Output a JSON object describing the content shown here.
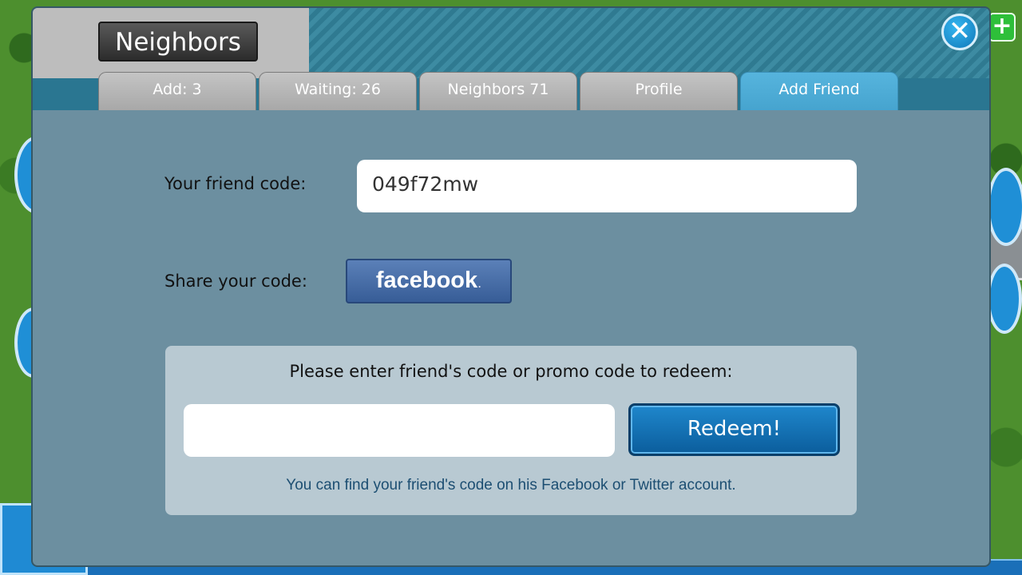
{
  "modal": {
    "title": "Neighbors",
    "close_icon": "close-icon"
  },
  "tabs": [
    {
      "label": "Add: 3",
      "active": false
    },
    {
      "label": "Waiting: 26",
      "active": false
    },
    {
      "label": "Neighbors 71",
      "active": false
    },
    {
      "label": "Profile",
      "active": false
    },
    {
      "label": "Add Friend",
      "active": true
    }
  ],
  "friend_code": {
    "label": "Your friend code:",
    "value": "049f72mw"
  },
  "share": {
    "label": "Share your code:",
    "facebook_label": "facebook",
    "facebook_dot": "."
  },
  "redeem": {
    "prompt": "Please enter friend's code or promo code to redeem:",
    "input_value": "",
    "button_label": "Redeem!",
    "hint": "You can find your friend's code on his Facebook or Twitter account."
  },
  "colors": {
    "active_tab": "#4aa8d3",
    "panel": "#6c8fa0",
    "facebook": "#3b5998",
    "redeem_button": "#1177c0"
  }
}
